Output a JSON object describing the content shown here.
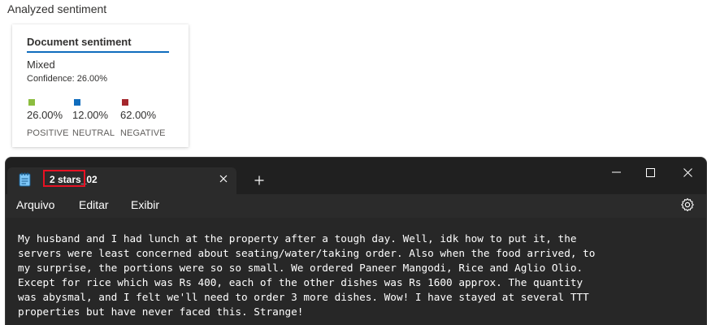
{
  "sentiment_panel": {
    "heading": "Analyzed sentiment",
    "card": {
      "title": "Document sentiment",
      "overall": "Mixed",
      "confidence": "Confidence: 26.00%",
      "metrics": [
        {
          "percent": "26.00%",
          "label": "POSITIVE",
          "color": "#8cbd3f"
        },
        {
          "percent": "12.00%",
          "label": "NEUTRAL",
          "color": "#0f6cbd"
        },
        {
          "percent": "62.00%",
          "label": "NEGATIVE",
          "color": "#a4262c"
        }
      ]
    }
  },
  "notepad": {
    "tab_title": "2 stars_02",
    "menu": [
      "Arquivo",
      "Editar",
      "Exibir"
    ],
    "highlight_color": "#e81123",
    "content": "My husband and I had lunch at the property after a tough day. Well, idk how to put it, the\nservers were least concerned about seating/water/taking order. Also when the food arrived, to\nmy surprise, the portions were so so small. We ordered Paneer Mangodi, Rice and Aglio Olio.\nExcept for rice which was Rs 400, each of the other dishes was Rs 1600 approx. The quantity\nwas abysmal, and I felt we'll need to order 3 more dishes. Wow! I have stayed at several TTT\nproperties but have never faced this. Strange!"
  }
}
